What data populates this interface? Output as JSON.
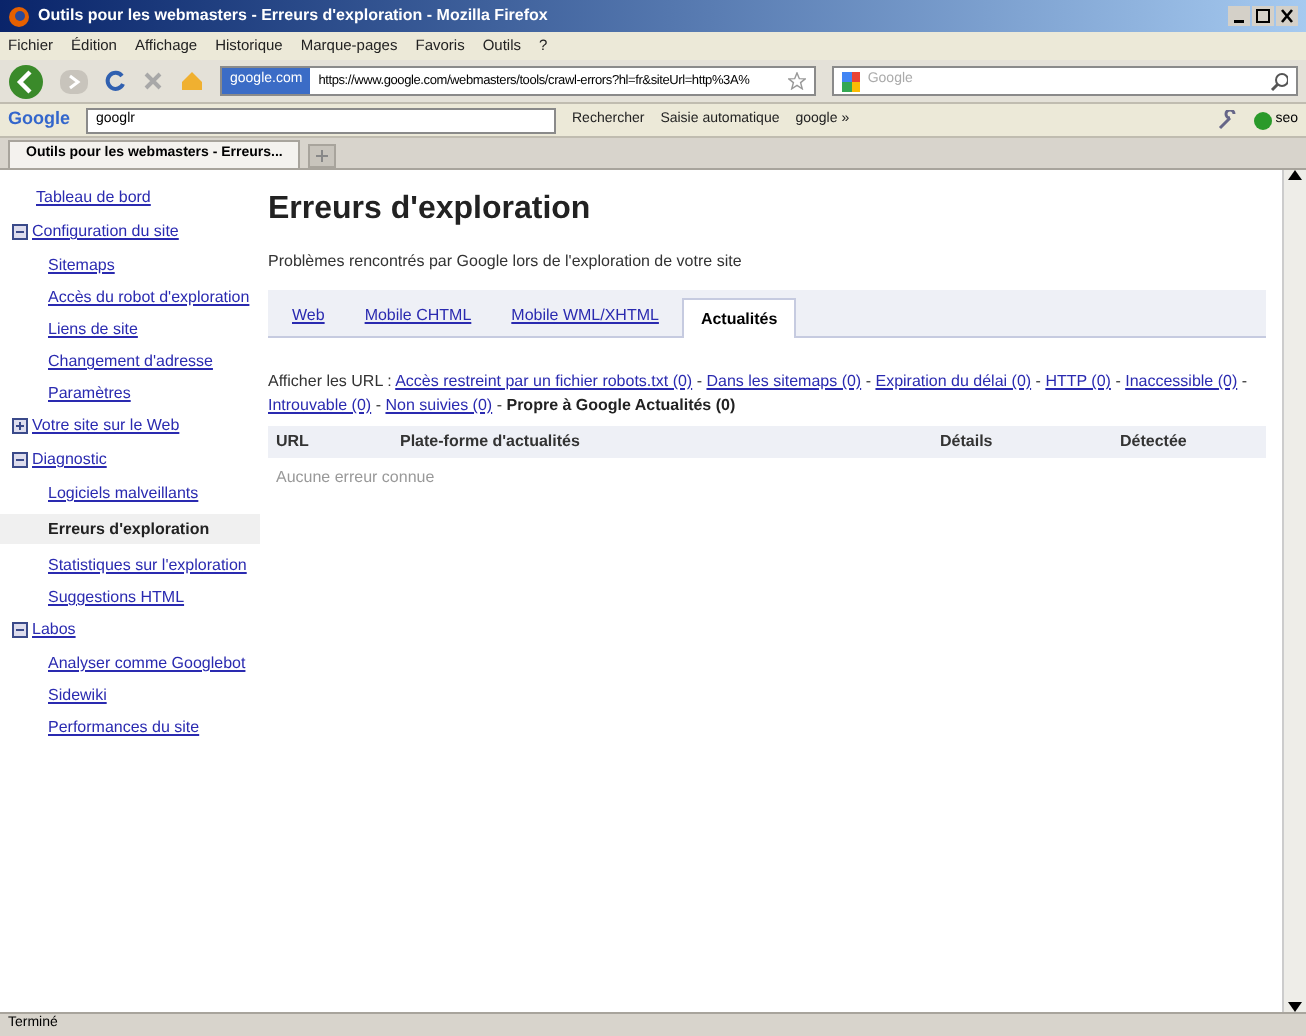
{
  "window": {
    "title": "Outils pour les webmasters - Erreurs d'exploration - Mozilla Firefox"
  },
  "menu": [
    "Fichier",
    "Édition",
    "Affichage",
    "Historique",
    "Marque-pages",
    "Favoris",
    "Outils",
    "?"
  ],
  "address_bar": {
    "site": "google.com",
    "url": "https://www.google.com/webmasters/tools/crawl-errors?hl=fr&siteUrl=http%3A%"
  },
  "search_field": {
    "placeholder": "Google"
  },
  "google_toolbar": {
    "logo": "Google",
    "query": "googlr",
    "items": [
      "Rechercher",
      "Saisie automatique",
      "google »"
    ],
    "profile": "seo"
  },
  "browser_tabs": [
    {
      "title": "Outils pour les webmasters - Erreurs...",
      "selected": true
    }
  ],
  "sidebar": {
    "items": [
      {
        "label": "Tableau de bord",
        "selected": false
      },
      {
        "label": "Configuration du site",
        "expanded": true,
        "children": [
          {
            "label": "Sitemaps",
            "selected": false
          },
          {
            "label": "Accès du robot d'exploration",
            "selected": false
          },
          {
            "label": "Liens de site",
            "selected": false
          },
          {
            "label": "Changement d'adresse",
            "selected": false
          },
          {
            "label": "Paramètres",
            "selected": false
          }
        ]
      },
      {
        "label": "Votre site sur le Web",
        "expanded": false
      },
      {
        "label": "Diagnostic",
        "expanded": true,
        "children": [
          {
            "label": "Logiciels malveillants",
            "selected": false
          },
          {
            "label": "Erreurs d'exploration",
            "selected": true
          },
          {
            "label": "Statistiques sur l'exploration",
            "selected": false
          },
          {
            "label": "Suggestions HTML",
            "selected": false
          }
        ]
      },
      {
        "label": "Labos",
        "expanded": true,
        "children": [
          {
            "label": "Analyser comme Googlebot",
            "selected": false
          },
          {
            "label": "Sidewiki",
            "selected": false
          },
          {
            "label": "Performances du site",
            "selected": false
          }
        ]
      }
    ]
  },
  "main": {
    "title": "Erreurs d'exploration",
    "subtitle": "Problèmes rencontrés par Google lors de l'exploration de votre site",
    "tabs": [
      {
        "label": "Web",
        "selected": false
      },
      {
        "label": "Mobile CHTML",
        "selected": false
      },
      {
        "label": "Mobile WML/XHTML",
        "selected": false
      },
      {
        "label": "Actualités",
        "selected": true
      }
    ],
    "filter_label": "Afficher les URL :",
    "separator": "-",
    "filters": [
      {
        "label": "Accès restreint par un fichier robots.txt (0)",
        "selected": false
      },
      {
        "label": "Dans les sitemaps (0)",
        "selected": false
      },
      {
        "label": "Expiration du délai (0)",
        "selected": false
      },
      {
        "label": "HTTP (0)",
        "selected": false
      },
      {
        "label": "Inaccessible (0)",
        "selected": false
      },
      {
        "label": "Introuvable (0)",
        "selected": false
      },
      {
        "label": "Non suivies (0)",
        "selected": false
      },
      {
        "label": "Propre à Google Actualités (0)",
        "selected": true
      }
    ],
    "table": {
      "columns": [
        "URL",
        "Plate-forme d'actualités",
        "Détails",
        "Détectée"
      ],
      "empty_text": "Aucune erreur connue"
    }
  },
  "status_bar": {
    "text": "Terminé"
  }
}
